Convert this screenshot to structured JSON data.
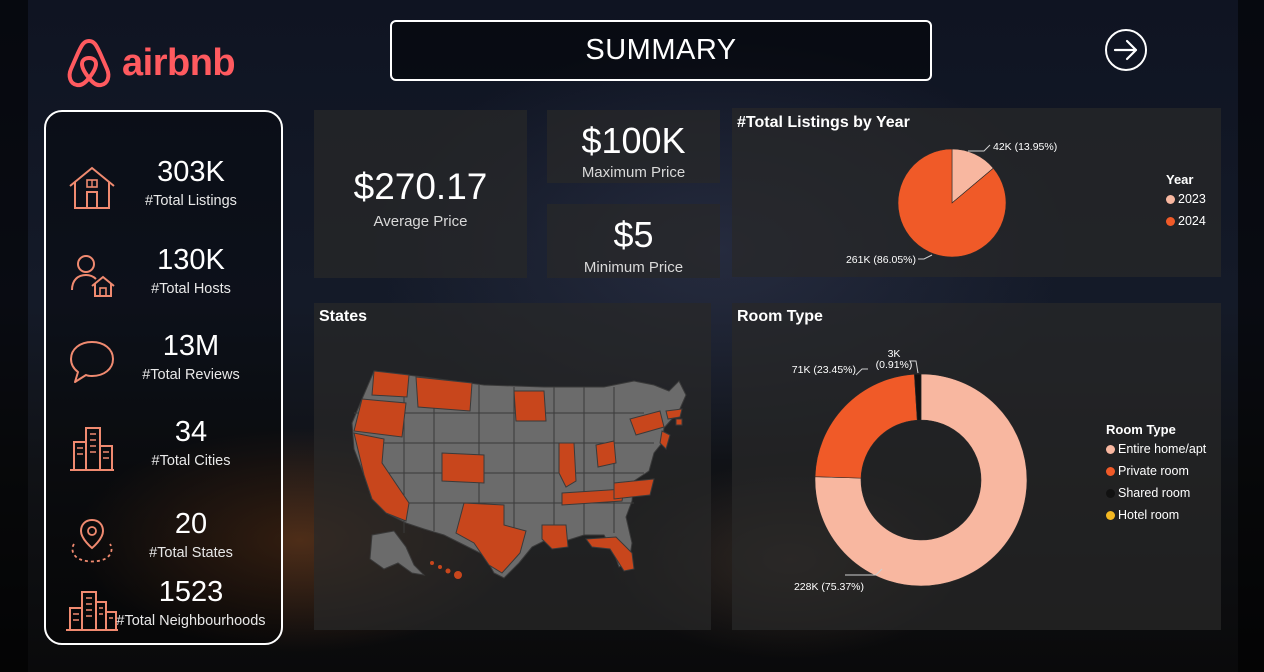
{
  "header": {
    "brand": "airbnb",
    "title": "SUMMARY",
    "next_icon": "arrow-right-circle-icon"
  },
  "kpis": [
    {
      "value": "303K",
      "label": "#Total Listings",
      "icon": "house-icon"
    },
    {
      "value": "130K",
      "label": "#Total Hosts",
      "icon": "host-person-icon"
    },
    {
      "value": "13M",
      "label": "#Total Reviews",
      "icon": "speech-bubble-icon"
    },
    {
      "value": "34",
      "label": "#Total Cities",
      "icon": "city-buildings-icon"
    },
    {
      "value": "20",
      "label": "#Total States",
      "icon": "map-pin-icon"
    },
    {
      "value": "1523",
      "label": "#Total Neighbourhoods",
      "icon": "neighbourhood-icon"
    }
  ],
  "prices": {
    "average": {
      "value": "$270.17",
      "label": "Average Price"
    },
    "maximum": {
      "value": "$100K",
      "label": "Maximum Price"
    },
    "minimum": {
      "value": "$5",
      "label": "Minimum Price"
    }
  },
  "colors": {
    "accent": "#ff5a5f",
    "orange": "#f05a28",
    "peach": "#f8b7a0",
    "shared": "#111111",
    "hotel": "#f2b722",
    "state_highlight": "#c8461c",
    "state_default": "#6b6b6b"
  },
  "chart_data": [
    {
      "type": "pie",
      "title": "#Total Listings by Year",
      "legend_title": "Year",
      "legend_position": "right",
      "categories": [
        "2023",
        "2024"
      ],
      "values": [
        42000,
        261000
      ],
      "data_labels": [
        "42K (13.95%)",
        "261K (86.05%)"
      ],
      "colors": [
        "#f8b7a0",
        "#f05a28"
      ]
    },
    {
      "type": "donut",
      "title": "Room Type",
      "legend_title": "Room Type",
      "legend_position": "right",
      "categories": [
        "Entire home/apt",
        "Private room",
        "Shared room",
        "Hotel room"
      ],
      "values": [
        228000,
        71000,
        3000,
        0
      ],
      "data_labels": [
        "228K (75.37%)",
        "71K (23.45%)",
        "3K (0.91%)",
        ""
      ],
      "colors": [
        "#f8b7a0",
        "#f05a28",
        "#111111",
        "#f2b722"
      ]
    }
  ],
  "map": {
    "title": "States"
  }
}
